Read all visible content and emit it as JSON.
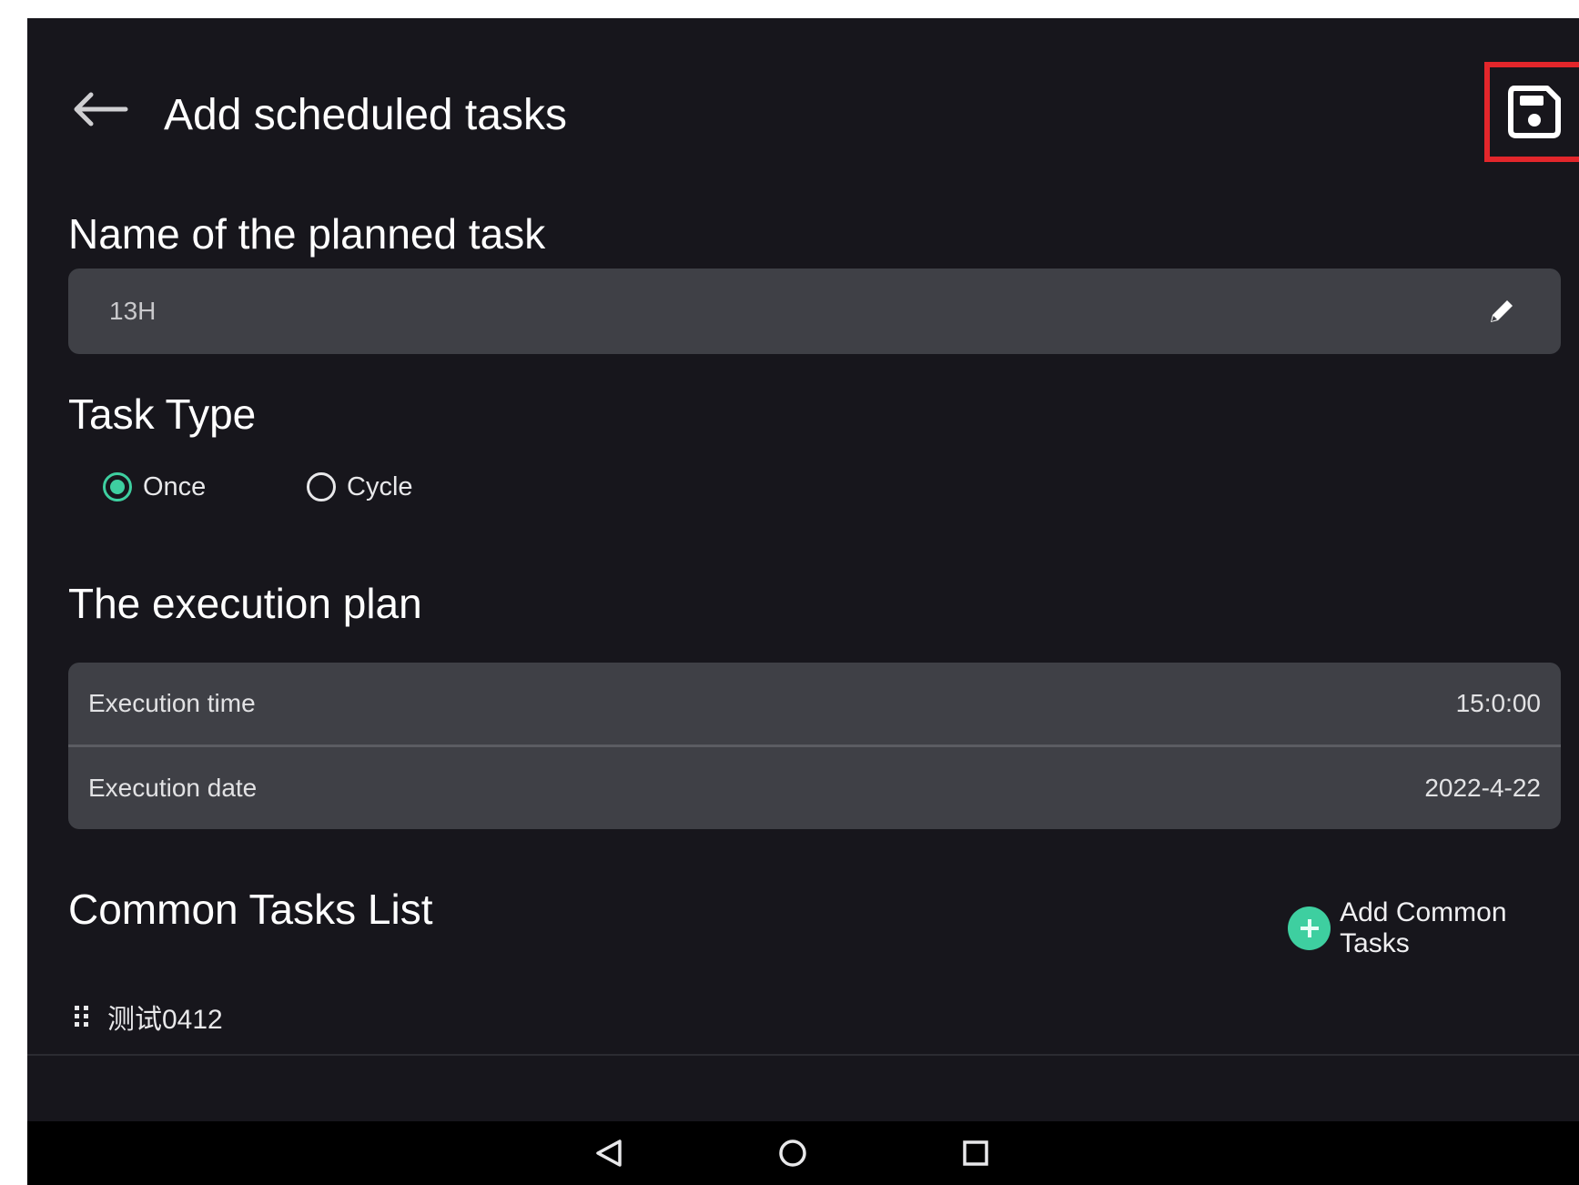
{
  "header": {
    "title": "Add scheduled tasks"
  },
  "task_name": {
    "label": "Name of the planned task",
    "value": "13H"
  },
  "task_type": {
    "label": "Task Type",
    "options": [
      {
        "label": "Once",
        "selected": true
      },
      {
        "label": "Cycle",
        "selected": false
      }
    ]
  },
  "execution_plan": {
    "label": "The execution plan",
    "rows": [
      {
        "label": "Execution time",
        "value": "15:0:00"
      },
      {
        "label": "Execution date",
        "value": "2022-4-22"
      }
    ]
  },
  "common_tasks": {
    "label": "Common Tasks List",
    "add_label": "Add Common Tasks",
    "items": [
      {
        "label": "测试0412"
      }
    ]
  },
  "colors": {
    "background": "#17161c",
    "field": "#3f4046",
    "accent": "#3ecfa0",
    "highlight": "#e3262b"
  },
  "icons": [
    "back-arrow-icon",
    "save-icon",
    "edit-pencil-icon",
    "plus-icon",
    "drag-handle-icon",
    "nav-back-icon",
    "nav-home-icon",
    "nav-recents-icon"
  ]
}
